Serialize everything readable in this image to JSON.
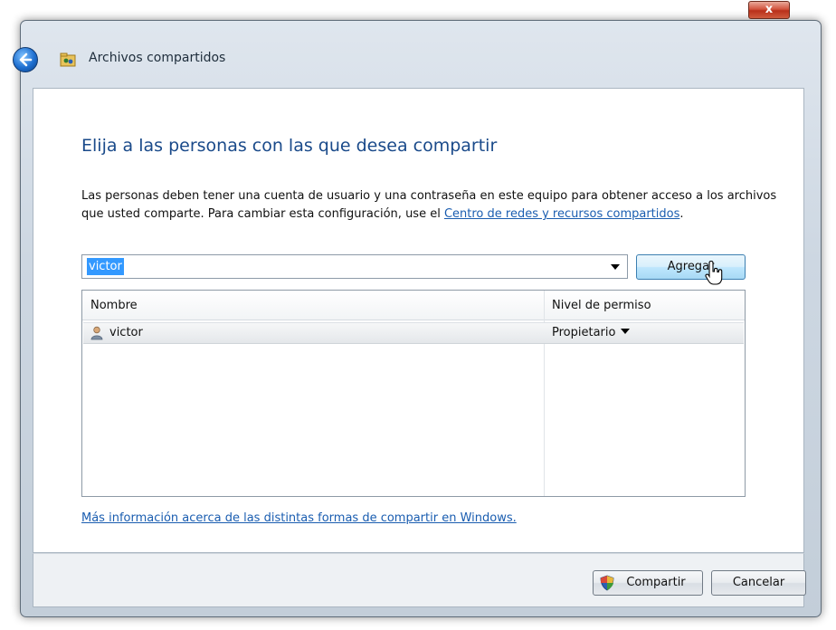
{
  "window": {
    "title": "Archivos compartidos",
    "close_symbol": "x"
  },
  "icons": {
    "back": "back-arrow-icon",
    "app": "share-folder-icon",
    "user": "user-icon",
    "shield": "uac-shield-icon"
  },
  "page": {
    "heading": "Elija a las personas con las que desea compartir",
    "description_text": "Las personas deben tener una cuenta de usuario y una contraseña en este equipo para obtener acceso a los archivos que usted comparte. Para cambiar esta configuración, use el ",
    "description_link": "Centro de redes y recursos compartidos",
    "description_end": "."
  },
  "user_combo": {
    "value": "victor"
  },
  "add_button": {
    "label": "Agregar"
  },
  "table": {
    "columns": [
      "Nombre",
      "Nivel de permiso"
    ],
    "rows": [
      {
        "name": "victor",
        "permission": "Propietario"
      }
    ]
  },
  "more_info_link": "Más información acerca de las distintas formas de compartir en Windows.",
  "footer": {
    "share_label": "Compartir",
    "cancel_label": "Cancelar"
  },
  "colors": {
    "heading": "#1a4a8a",
    "link": "#1a5db0",
    "selection": "#3399ff"
  }
}
